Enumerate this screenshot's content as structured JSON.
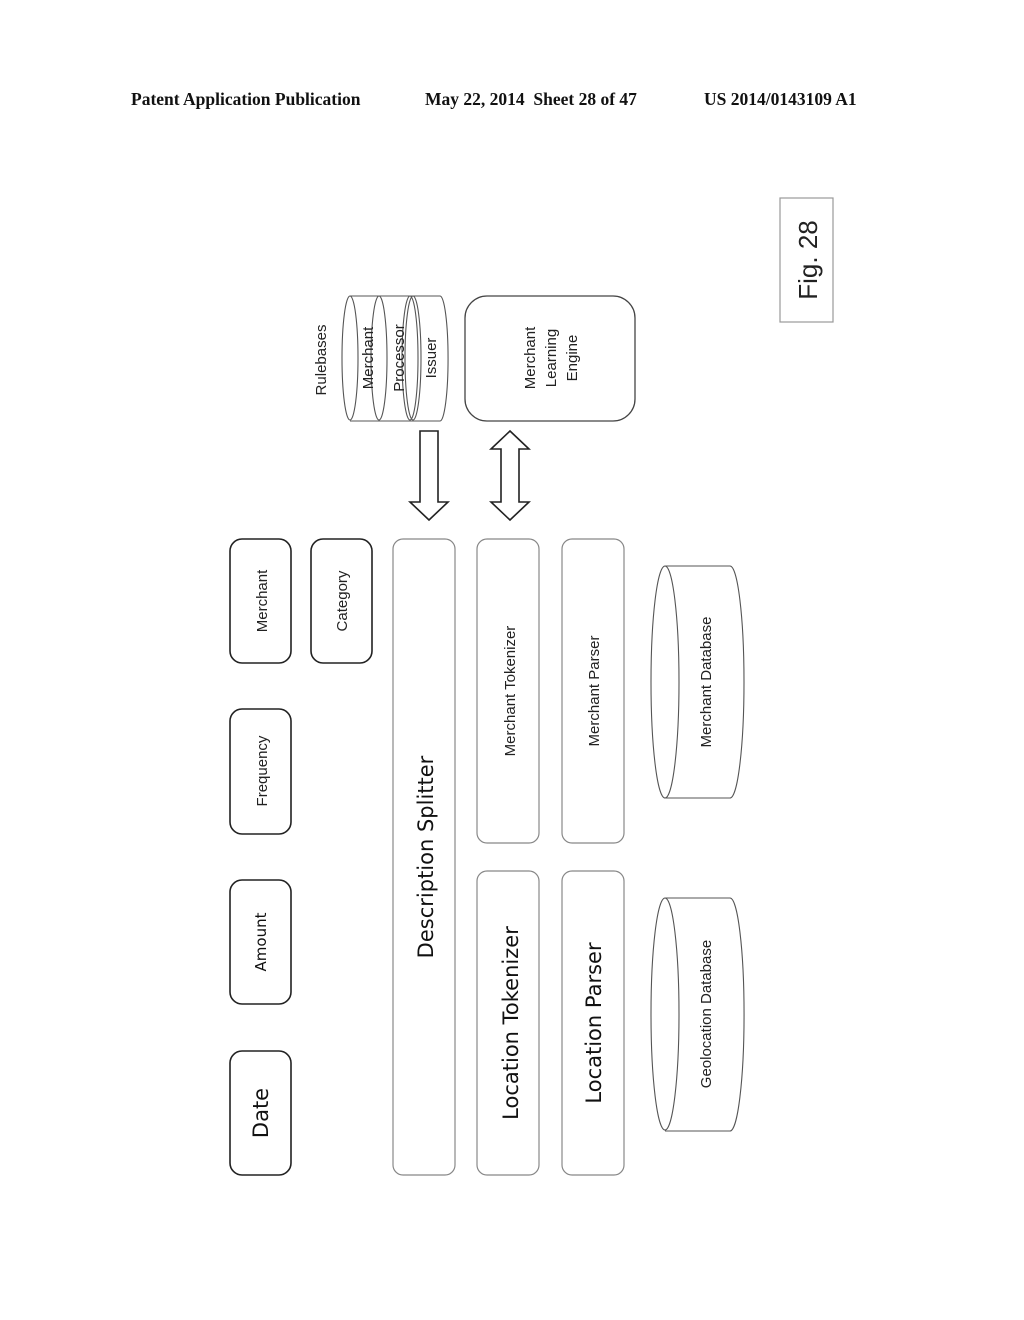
{
  "header": {
    "publication": "Patent Application Publication",
    "date_sheet": "May 22, 2014  Sheet 28 of 47",
    "number": "US 2014/0143109 A1"
  },
  "figure_label": "Fig. 28",
  "inputs": [
    {
      "label": "Date"
    },
    {
      "label": "Amount"
    },
    {
      "label": "Frequency"
    },
    {
      "label": "Merchant"
    },
    {
      "label": "Category"
    }
  ],
  "components": {
    "description_splitter": "Description Splitter",
    "location_tokenizer": "Location Tokenizer",
    "merchant_tokenizer": "Merchant Tokenizer",
    "location_parser": "Location Parser",
    "merchant_parser": "Merchant Parser",
    "geolocation_database": "Geolocation Database",
    "merchant_database": "Merchant Database",
    "merchant_learning_engine": [
      "Merchant",
      "Learning",
      "Engine"
    ]
  },
  "rulebases": {
    "title": "Rulebases",
    "items": [
      "Merchant",
      "Processor",
      "Issuer"
    ]
  }
}
